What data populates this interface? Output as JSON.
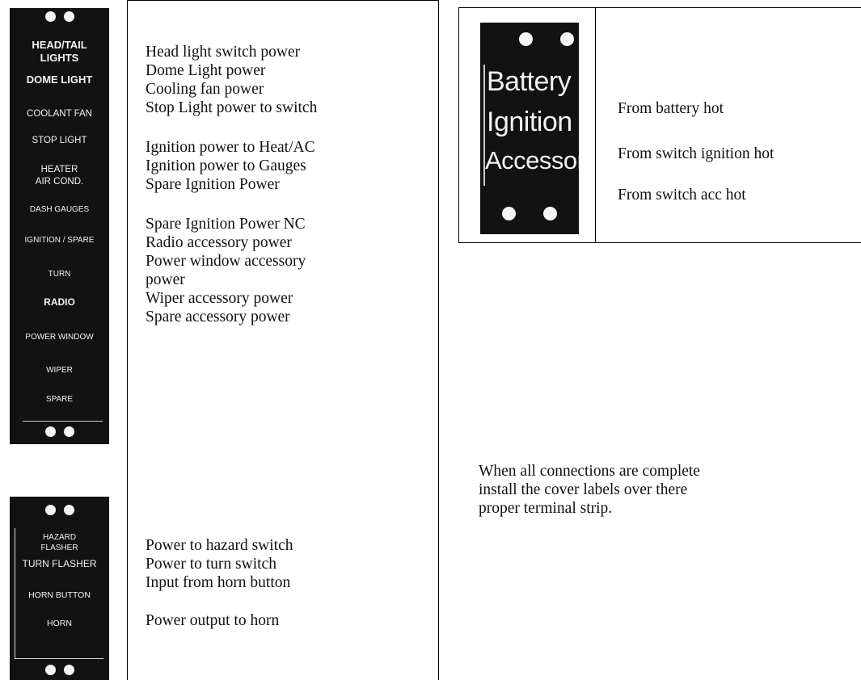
{
  "main_strip": {
    "labels": [
      "HEAD/TAIL",
      "LIGHTS",
      "DOME LIGHT",
      "COOLANT FAN",
      "STOP LIGHT",
      "HEATER",
      "AIR COND.",
      "DASH GAUGES",
      "IGNITION / SPARE",
      "TURN",
      "RADIO",
      "POWER WINDOW",
      "WIPER",
      "SPARE"
    ]
  },
  "main_descriptions": [
    "Head light switch power",
    "Dome Light power",
    "Cooling fan power",
    "Stop Light power to switch",
    "Ignition power to Heat/AC",
    "Ignition power to Gauges",
    "Spare Ignition Power",
    "Spare Ignition Power NC",
    "Radio accessory power",
    "Power window accessory",
    "power",
    "Wiper accessory power",
    "Spare accessory power"
  ],
  "horn_strip": {
    "labels": [
      "HAZARD",
      "FLASHER",
      "TURN FLASHER",
      "HORN BUTTON",
      "HORN"
    ]
  },
  "horn_descriptions": [
    "Power to hazard switch",
    "Power to turn switch",
    "Input from horn button",
    "Power output to horn"
  ],
  "battery_strip": {
    "labels": [
      "Battery",
      "Ignition",
      "Accessory"
    ]
  },
  "battery_descriptions": [
    "From battery hot",
    "From switch ignition hot",
    "From switch acc hot"
  ],
  "note": "When all connections are complete install the cover labels over there proper terminal strip."
}
